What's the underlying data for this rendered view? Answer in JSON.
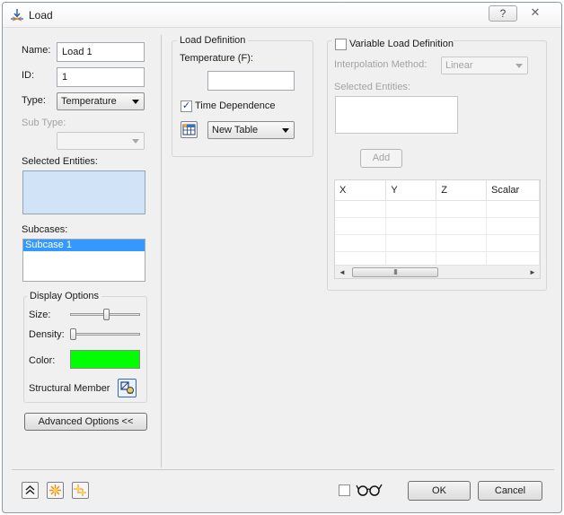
{
  "window": {
    "title": "Load",
    "help_label": "?",
    "close_label": "✕"
  },
  "left": {
    "name_label": "Name:",
    "name_value": "Load 1",
    "id_label": "ID:",
    "id_value": "1",
    "type_label": "Type:",
    "type_value": "Temperature",
    "subtype_label": "Sub Type:",
    "subtype_value": "",
    "selected_entities_label": "Selected Entities:",
    "subcases_label": "Subcases:",
    "subcases": [
      "Subcase 1"
    ],
    "display_options": {
      "title": "Display Options",
      "size_label": "Size:",
      "size_level": 0.52,
      "density_label": "Density:",
      "density_level": 0.0,
      "color_label": "Color:",
      "color_value": "#00ff00",
      "structural_member_label": "Structural Member"
    },
    "advanced_button": "Advanced Options <<"
  },
  "load_definition": {
    "title": "Load Definition",
    "temperature_label": "Temperature (F):",
    "temperature_value": "",
    "time_dependence_label": "Time Dependence",
    "time_dependence_checked": true,
    "table_value": "New Table"
  },
  "variable": {
    "checkbox_label": "Variable Load Definition",
    "checked": false,
    "interpolation_label": "Interpolation Method:",
    "interpolation_value": "Linear",
    "selected_entities_label": "Selected Entities:",
    "add_button": "Add",
    "columns": [
      "X",
      "Y",
      "Z",
      "Scalar"
    ],
    "empty_rows": 4
  },
  "footer": {
    "ok_label": "OK",
    "cancel_label": "Cancel",
    "review_checked": false
  },
  "colors": {
    "selection_blue": "#3399ff",
    "entities_fill": "#d1e3f7",
    "color_swatch": "#00ff00"
  }
}
